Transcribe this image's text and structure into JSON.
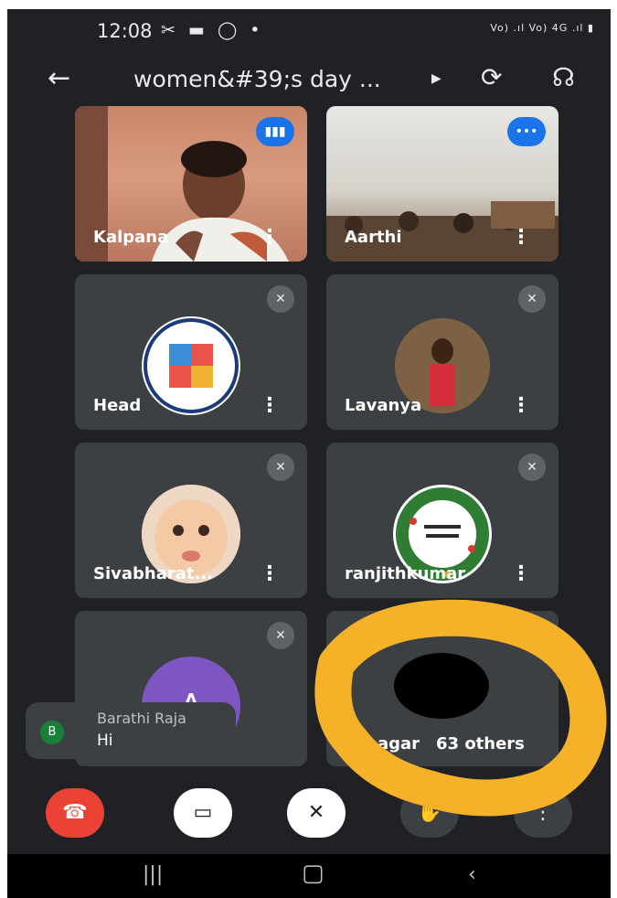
{
  "status": {
    "time": "12:08",
    "icons": "✂ ▬ ◯ •",
    "right": "Vo) .ıl Vo) 4G .ıl ▮"
  },
  "header": {
    "title": "women&#39;s day ...",
    "play_icon": "play-arrow-icon"
  },
  "tiles": [
    {
      "name": "Kalpana"
    },
    {
      "name": "Aarthi"
    },
    {
      "name": "Head"
    },
    {
      "name": "Lavanya"
    },
    {
      "name": "Sivabharat..."
    },
    {
      "name": "ranjithkumar"
    },
    {
      "avatar_letter": "A"
    },
    {
      "name_fragment": "agar",
      "others": "63 others"
    }
  ],
  "chat": {
    "initial": "B",
    "sender": "Barathi Raja",
    "message": "Hi"
  },
  "colors": {
    "end_call": "#ea4335",
    "accent": "#1a73e8",
    "annotation": "#f5b229"
  }
}
